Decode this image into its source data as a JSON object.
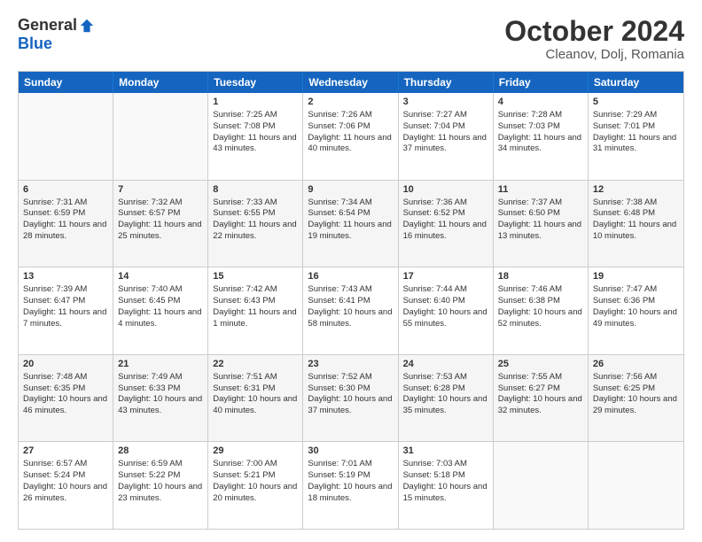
{
  "header": {
    "logo_general": "General",
    "logo_blue": "Blue",
    "title": "October 2024",
    "location": "Cleanov, Dolj, Romania"
  },
  "days_of_week": [
    "Sunday",
    "Monday",
    "Tuesday",
    "Wednesday",
    "Thursday",
    "Friday",
    "Saturday"
  ],
  "weeks": [
    [
      {
        "day": "",
        "empty": true
      },
      {
        "day": "",
        "empty": true
      },
      {
        "day": "1",
        "sunrise": "Sunrise: 7:25 AM",
        "sunset": "Sunset: 7:08 PM",
        "daylight": "Daylight: 11 hours and 43 minutes."
      },
      {
        "day": "2",
        "sunrise": "Sunrise: 7:26 AM",
        "sunset": "Sunset: 7:06 PM",
        "daylight": "Daylight: 11 hours and 40 minutes."
      },
      {
        "day": "3",
        "sunrise": "Sunrise: 7:27 AM",
        "sunset": "Sunset: 7:04 PM",
        "daylight": "Daylight: 11 hours and 37 minutes."
      },
      {
        "day": "4",
        "sunrise": "Sunrise: 7:28 AM",
        "sunset": "Sunset: 7:03 PM",
        "daylight": "Daylight: 11 hours and 34 minutes."
      },
      {
        "day": "5",
        "sunrise": "Sunrise: 7:29 AM",
        "sunset": "Sunset: 7:01 PM",
        "daylight": "Daylight: 11 hours and 31 minutes."
      }
    ],
    [
      {
        "day": "6",
        "sunrise": "Sunrise: 7:31 AM",
        "sunset": "Sunset: 6:59 PM",
        "daylight": "Daylight: 11 hours and 28 minutes."
      },
      {
        "day": "7",
        "sunrise": "Sunrise: 7:32 AM",
        "sunset": "Sunset: 6:57 PM",
        "daylight": "Daylight: 11 hours and 25 minutes."
      },
      {
        "day": "8",
        "sunrise": "Sunrise: 7:33 AM",
        "sunset": "Sunset: 6:55 PM",
        "daylight": "Daylight: 11 hours and 22 minutes."
      },
      {
        "day": "9",
        "sunrise": "Sunrise: 7:34 AM",
        "sunset": "Sunset: 6:54 PM",
        "daylight": "Daylight: 11 hours and 19 minutes."
      },
      {
        "day": "10",
        "sunrise": "Sunrise: 7:36 AM",
        "sunset": "Sunset: 6:52 PM",
        "daylight": "Daylight: 11 hours and 16 minutes."
      },
      {
        "day": "11",
        "sunrise": "Sunrise: 7:37 AM",
        "sunset": "Sunset: 6:50 PM",
        "daylight": "Daylight: 11 hours and 13 minutes."
      },
      {
        "day": "12",
        "sunrise": "Sunrise: 7:38 AM",
        "sunset": "Sunset: 6:48 PM",
        "daylight": "Daylight: 11 hours and 10 minutes."
      }
    ],
    [
      {
        "day": "13",
        "sunrise": "Sunrise: 7:39 AM",
        "sunset": "Sunset: 6:47 PM",
        "daylight": "Daylight: 11 hours and 7 minutes."
      },
      {
        "day": "14",
        "sunrise": "Sunrise: 7:40 AM",
        "sunset": "Sunset: 6:45 PM",
        "daylight": "Daylight: 11 hours and 4 minutes."
      },
      {
        "day": "15",
        "sunrise": "Sunrise: 7:42 AM",
        "sunset": "Sunset: 6:43 PM",
        "daylight": "Daylight: 11 hours and 1 minute."
      },
      {
        "day": "16",
        "sunrise": "Sunrise: 7:43 AM",
        "sunset": "Sunset: 6:41 PM",
        "daylight": "Daylight: 10 hours and 58 minutes."
      },
      {
        "day": "17",
        "sunrise": "Sunrise: 7:44 AM",
        "sunset": "Sunset: 6:40 PM",
        "daylight": "Daylight: 10 hours and 55 minutes."
      },
      {
        "day": "18",
        "sunrise": "Sunrise: 7:46 AM",
        "sunset": "Sunset: 6:38 PM",
        "daylight": "Daylight: 10 hours and 52 minutes."
      },
      {
        "day": "19",
        "sunrise": "Sunrise: 7:47 AM",
        "sunset": "Sunset: 6:36 PM",
        "daylight": "Daylight: 10 hours and 49 minutes."
      }
    ],
    [
      {
        "day": "20",
        "sunrise": "Sunrise: 7:48 AM",
        "sunset": "Sunset: 6:35 PM",
        "daylight": "Daylight: 10 hours and 46 minutes."
      },
      {
        "day": "21",
        "sunrise": "Sunrise: 7:49 AM",
        "sunset": "Sunset: 6:33 PM",
        "daylight": "Daylight: 10 hours and 43 minutes."
      },
      {
        "day": "22",
        "sunrise": "Sunrise: 7:51 AM",
        "sunset": "Sunset: 6:31 PM",
        "daylight": "Daylight: 10 hours and 40 minutes."
      },
      {
        "day": "23",
        "sunrise": "Sunrise: 7:52 AM",
        "sunset": "Sunset: 6:30 PM",
        "daylight": "Daylight: 10 hours and 37 minutes."
      },
      {
        "day": "24",
        "sunrise": "Sunrise: 7:53 AM",
        "sunset": "Sunset: 6:28 PM",
        "daylight": "Daylight: 10 hours and 35 minutes."
      },
      {
        "day": "25",
        "sunrise": "Sunrise: 7:55 AM",
        "sunset": "Sunset: 6:27 PM",
        "daylight": "Daylight: 10 hours and 32 minutes."
      },
      {
        "day": "26",
        "sunrise": "Sunrise: 7:56 AM",
        "sunset": "Sunset: 6:25 PM",
        "daylight": "Daylight: 10 hours and 29 minutes."
      }
    ],
    [
      {
        "day": "27",
        "sunrise": "Sunrise: 6:57 AM",
        "sunset": "Sunset: 5:24 PM",
        "daylight": "Daylight: 10 hours and 26 minutes."
      },
      {
        "day": "28",
        "sunrise": "Sunrise: 6:59 AM",
        "sunset": "Sunset: 5:22 PM",
        "daylight": "Daylight: 10 hours and 23 minutes."
      },
      {
        "day": "29",
        "sunrise": "Sunrise: 7:00 AM",
        "sunset": "Sunset: 5:21 PM",
        "daylight": "Daylight: 10 hours and 20 minutes."
      },
      {
        "day": "30",
        "sunrise": "Sunrise: 7:01 AM",
        "sunset": "Sunset: 5:19 PM",
        "daylight": "Daylight: 10 hours and 18 minutes."
      },
      {
        "day": "31",
        "sunrise": "Sunrise: 7:03 AM",
        "sunset": "Sunset: 5:18 PM",
        "daylight": "Daylight: 10 hours and 15 minutes."
      },
      {
        "day": "",
        "empty": true
      },
      {
        "day": "",
        "empty": true
      }
    ]
  ]
}
